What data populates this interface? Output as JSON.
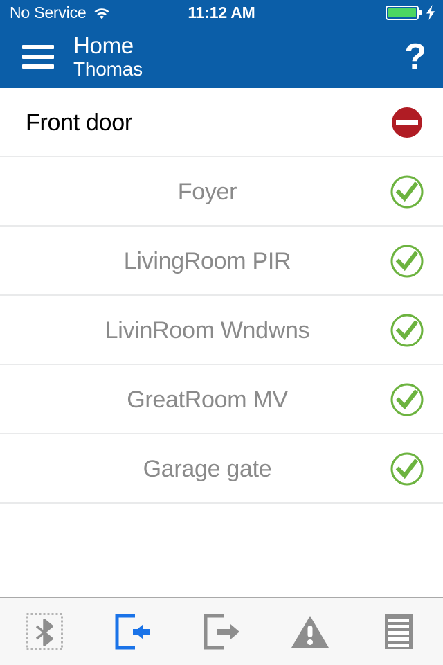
{
  "status_bar": {
    "carrier": "No Service",
    "wifi_icon": "wifi-icon",
    "clock": "11:12 AM",
    "battery_icon": "battery-full-icon",
    "charging_icon": "lightning-bolt-icon"
  },
  "header": {
    "menu_icon": "hamburger-menu-icon",
    "title": "Home",
    "subtitle": "Thomas",
    "help_label": "?",
    "background_color": "#0b5ea8"
  },
  "zones": [
    {
      "name": "Front door",
      "status": "faulted",
      "status_icon": "no-entry-icon",
      "status_color": "#b01c24",
      "highlighted": true
    },
    {
      "name": "Foyer",
      "status": "ready",
      "status_icon": "check-circle-icon",
      "status_color": "#6cb33f",
      "highlighted": false
    },
    {
      "name": "LivingRoom PIR",
      "status": "ready",
      "status_icon": "check-circle-icon",
      "status_color": "#6cb33f",
      "highlighted": false
    },
    {
      "name": "LivinRoom Wndwns",
      "status": "ready",
      "status_icon": "check-circle-icon",
      "status_color": "#6cb33f",
      "highlighted": false
    },
    {
      "name": "GreatRoom MV",
      "status": "ready",
      "status_icon": "check-circle-icon",
      "status_color": "#6cb33f",
      "highlighted": false
    },
    {
      "name": "Garage gate",
      "status": "ready",
      "status_icon": "check-circle-icon",
      "status_color": "#6cb33f",
      "highlighted": false
    }
  ],
  "toolbar": [
    {
      "name": "bluetooth-icon",
      "state": "disabled",
      "color": "#9a9a9a"
    },
    {
      "name": "arm-away-icon",
      "state": "active",
      "color": "#1a73e8"
    },
    {
      "name": "disarm-icon",
      "state": "normal",
      "color": "#8e8e8e"
    },
    {
      "name": "panic-alarm-icon",
      "state": "normal",
      "color": "#8e8e8e"
    },
    {
      "name": "event-log-icon",
      "state": "normal",
      "color": "#8e8e8e"
    }
  ],
  "colors": {
    "brand_blue": "#0b5ea8",
    "accent_blue": "#1a73e8",
    "ok_green": "#6cb33f",
    "alert_red": "#b01c24",
    "battery_green": "#4cd663",
    "separator": "#e9eaeb",
    "toolbar_bg": "#f7f7f7",
    "label_gray": "#8a8a8a"
  }
}
